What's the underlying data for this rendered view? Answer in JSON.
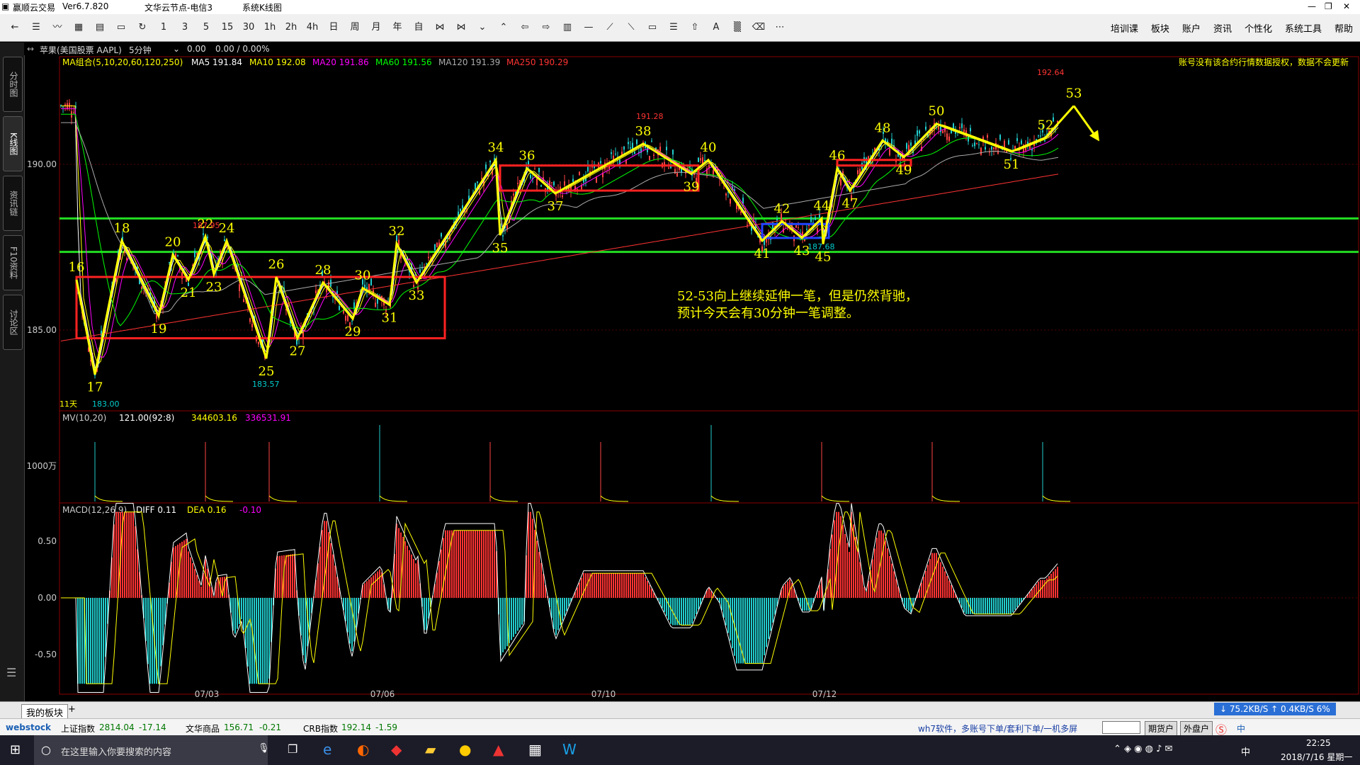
{
  "app": {
    "title": "赢顺云交易",
    "version": "Ver6.7.820",
    "server": "文华云节点-电信3",
    "window_label": "系统K线图"
  },
  "toolbar": {
    "periods": [
      "1",
      "3",
      "5",
      "15",
      "30",
      "1h",
      "2h",
      "4h",
      "日",
      "周",
      "月",
      "年",
      "自"
    ],
    "menu": [
      "培训课",
      "板块",
      "账户",
      "资讯",
      "个性化",
      "系统工具",
      "帮助"
    ]
  },
  "left_tabs": [
    "分时图",
    "K线图",
    "资讯链",
    "F10资料",
    "讨论区"
  ],
  "symbol": {
    "name": "苹果(美国股票 AAPL)",
    "period": "5分钟",
    "price": "0.00",
    "change": "0.00 / 0.00%"
  },
  "ma_legend": {
    "label": "MA组合(5,10,20,60,120,250)",
    "items": [
      {
        "text": "MA5 191.84",
        "color": "#ffffff"
      },
      {
        "text": "MA10 192.08",
        "color": "#ffff00"
      },
      {
        "text": "MA20 191.86",
        "color": "#ff00ff"
      },
      {
        "text": "MA60 191.56",
        "color": "#00ff00"
      },
      {
        "text": "MA120 191.39",
        "color": "#aaaaaa"
      },
      {
        "text": "MA250 190.29",
        "color": "#ff3333"
      }
    ]
  },
  "notice": "账号没有该合约行情数据授权，数据不会更新",
  "price_axis": {
    "ticks": [
      "190.00",
      "185.00"
    ]
  },
  "annotation_text": [
    "52-53向上继续延伸一笔，但是仍然背驰，",
    "预计今天会有30分钟一笔调整。"
  ],
  "day_count": "11天",
  "price_labels": {
    "low": "183.00",
    "high22": "187.95",
    "low25": "183.57",
    "high38": "191.28",
    "low45": "187.68",
    "high53": "192.64"
  },
  "volume_legend": {
    "label": "MV(10,20)",
    "v1": "121.00(92:8)",
    "v2": "344603.16",
    "v3": "336531.91",
    "axis": "1000万"
  },
  "macd_legend": {
    "label": "MACD(12,26,9)",
    "diff": "DIFF 0.11",
    "dea": "DEA 0.16",
    "macd": "-0.10",
    "axis": [
      "0.50",
      "0.00",
      "-0.50"
    ]
  },
  "date_labels": [
    "07/03",
    "07/06",
    "07/10",
    "07/12"
  ],
  "chart_data": {
    "type": "line",
    "title": "苹果(美国股票 AAPL) 5分钟",
    "ylim": [
      182.0,
      194.0
    ],
    "yticks": [
      185.0,
      190.0
    ],
    "stroke_pivots": {
      "labels": [
        "16",
        "17",
        "18",
        "19",
        "20",
        "21",
        "22",
        "23",
        "24",
        "25",
        "26",
        "27",
        "28",
        "29",
        "30",
        "31",
        "32",
        "33",
        "34",
        "35",
        "36",
        "37",
        "38",
        "39",
        "40",
        "41",
        "42",
        "43",
        "44",
        "45",
        "46",
        "47",
        "48",
        "49",
        "50",
        "51",
        "52",
        "53"
      ],
      "values": [
        186.4,
        183.0,
        187.8,
        185.1,
        187.3,
        186.4,
        187.95,
        186.6,
        187.8,
        183.57,
        186.5,
        184.3,
        186.3,
        185.0,
        186.1,
        185.5,
        187.7,
        186.3,
        190.7,
        188.0,
        190.4,
        189.5,
        191.28,
        190.2,
        190.7,
        187.8,
        188.5,
        187.9,
        188.6,
        187.68,
        190.4,
        189.6,
        191.4,
        190.8,
        192.0,
        191.0,
        191.5,
        192.64
      ]
    },
    "pivot_boxes": [
      {
        "color": "red",
        "from": "16",
        "to": "33",
        "top": 186.5,
        "bottom": 184.3
      },
      {
        "color": "red",
        "from": "35",
        "to": "39",
        "top": 190.5,
        "bottom": 189.6
      },
      {
        "color": "blue",
        "from": "41",
        "to": "44",
        "top": 188.4,
        "bottom": 187.9
      },
      {
        "color": "red",
        "from": "46",
        "to": "49",
        "top": 190.7,
        "bottom": 190.5
      }
    ],
    "horizontal_lines": [
      {
        "color": "green",
        "value": 188.6
      },
      {
        "color": "green",
        "value": 187.4
      }
    ],
    "volume_spikes": [
      1,
      1,
      1,
      1,
      1,
      1,
      1,
      1,
      1,
      1
    ],
    "macd_range": [
      -0.75,
      0.75
    ]
  },
  "bottom_tabs": {
    "active": "我的板块",
    "add": "+"
  },
  "ticker": {
    "logo": "webstock",
    "items": [
      {
        "name": "上证指数",
        "value": "2814.04",
        "chg": "-17.14"
      },
      {
        "name": "文华商品",
        "value": "156.71",
        "chg": "-0.21"
      },
      {
        "name": "CRB指数",
        "value": "192.14",
        "chg": "-1.59"
      }
    ],
    "promo": "wh7软件，多账号下单/套利下单/一机多屏",
    "buttons": [
      "期货户",
      "外盘户"
    ],
    "net": {
      "down": "75.2KB/S",
      "up": "0.4KB/S",
      "pct": "6%"
    }
  },
  "taskbar": {
    "search": "在这里输入你要搜索的内容",
    "time": "22:25",
    "date": "2018/7/16 星期一",
    "ime": "中"
  }
}
